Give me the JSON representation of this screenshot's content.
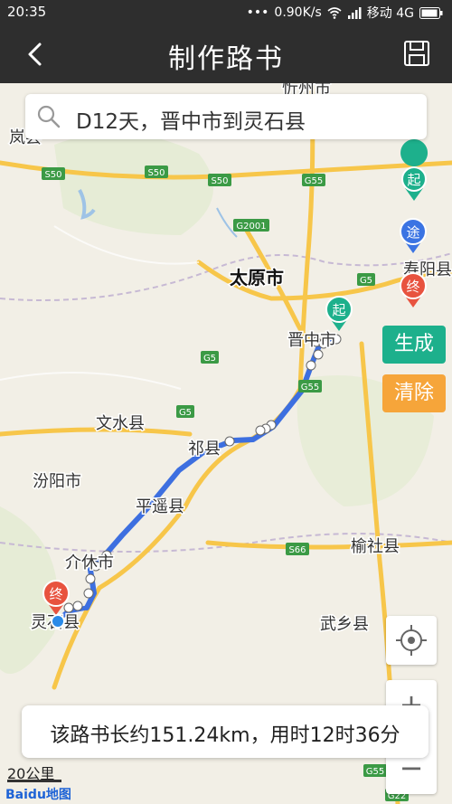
{
  "status": {
    "time": "20:35",
    "speed": "0.90K/s",
    "carrier": "移动 4G"
  },
  "header": {
    "title": "制作路书"
  },
  "search": {
    "text": "D12天，晋中市到灵石县"
  },
  "buttons": {
    "generate": "生成",
    "clear": "清除",
    "zoom_in": "+",
    "zoom_out": "−"
  },
  "summary": {
    "text": "该路书长约151.24km，用时12时36分"
  },
  "scale": {
    "label": "20公里"
  },
  "brand": {
    "logo": "Baidu地图"
  },
  "map": {
    "places": [
      "忻州市",
      "岚县",
      "太原市",
      "寿阳县",
      "晋中市",
      "文水县",
      "祁县",
      "汾阳市",
      "平遥县",
      "介休市",
      "榆社县",
      "灵石县",
      "武乡县"
    ],
    "roads": [
      "S50",
      "S50",
      "S50",
      "G55",
      "G2001",
      "G5",
      "G5",
      "G5",
      "G55",
      "S66",
      "G55",
      "G22"
    ],
    "markers": {
      "start": "起",
      "via": "途",
      "end": "终"
    }
  },
  "colors": {
    "route": "#3d6fe0",
    "generate": "#1db08c",
    "clear": "#f6a53a",
    "start": "#1db08c",
    "via": "#3b74e3",
    "end": "#e8533f"
  }
}
